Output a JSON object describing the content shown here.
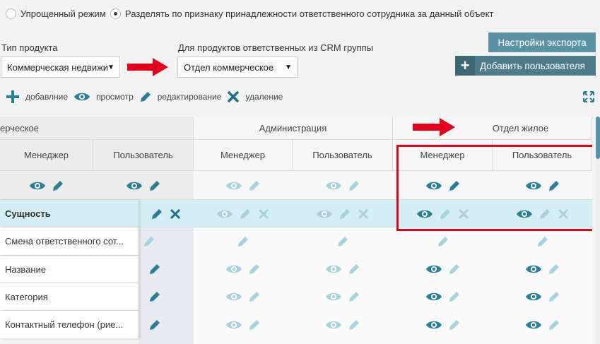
{
  "mode": {
    "simple_label": "Упрощенный режим",
    "split_label": "Разделять по признаку принадлежности ответственного сотрудника за данный объект"
  },
  "product_type": {
    "label": "Тип продукта",
    "value": "Коммерческая недвижи"
  },
  "crm_group": {
    "label": "Для продуктов ответственных из CRM группы",
    "value": "Отдел коммерческое"
  },
  "buttons": {
    "export": "Настройки экспорта",
    "add_user": "Добавить пользователя",
    "add_icon": "+"
  },
  "legend": {
    "add": "добавлние",
    "view": "просмотр",
    "edit": "редактирование",
    "delete": "удаление"
  },
  "colors": {
    "accent": "#5b93a6",
    "icon_active": "#2a7f95",
    "icon_inactive": "#a7d3dd",
    "delete_active": "#1e6f87",
    "highlight_row": "#d3eef5",
    "red": "#e3001b"
  },
  "table": {
    "groups": [
      "ерческое",
      "Администрация",
      "Отдел жилое"
    ],
    "roles": [
      "Менеджер",
      "Пользователь",
      "Менеджер",
      "Пользователь",
      "Менеджер",
      "Пользователь"
    ],
    "rows": [
      "Сущность",
      "Смена ответственного сот...",
      "Название",
      "Категория",
      "Контактный телефон (рие..."
    ]
  }
}
